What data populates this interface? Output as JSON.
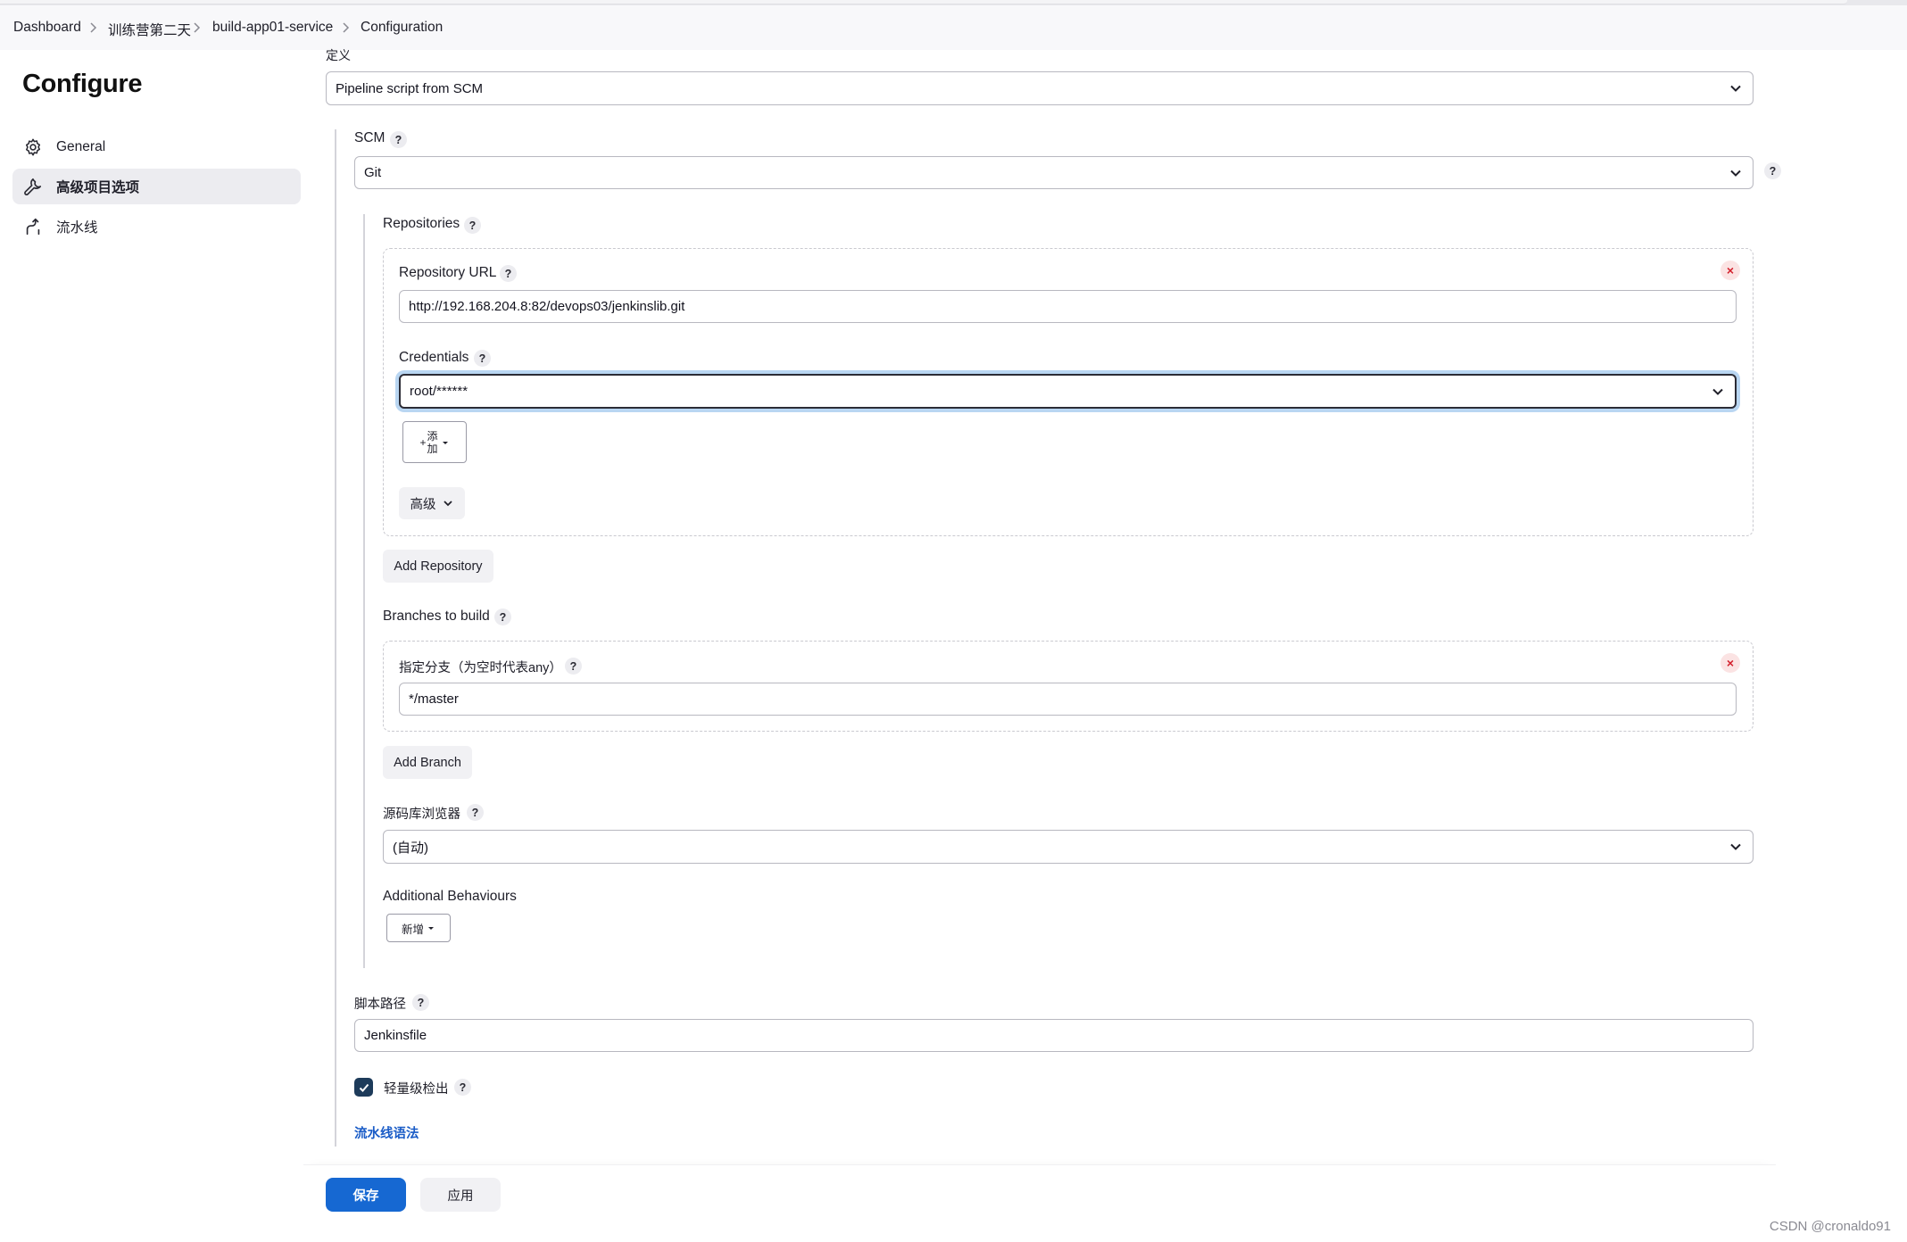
{
  "breadcrumb": {
    "items": [
      "Dashboard",
      "训练营第二天",
      "build-app01-service",
      "Configuration"
    ]
  },
  "sidebar": {
    "title": "Configure",
    "items": [
      {
        "label": "General",
        "icon": "gear-icon"
      },
      {
        "label": "高级项目选项",
        "icon": "wrench-icon",
        "active": true
      },
      {
        "label": "流水线",
        "icon": "pipeline-icon"
      }
    ]
  },
  "definition": {
    "label": "定义",
    "value": "Pipeline script from SCM"
  },
  "scm": {
    "label": "SCM",
    "value": "Git"
  },
  "repositories": {
    "label": "Repositories",
    "url_label": "Repository URL",
    "url_value": "http://192.168.204.8:82/devops03/jenkinslib.git",
    "credentials_label": "Credentials",
    "credentials_value": "root/******",
    "add_label_line1": "添",
    "add_label_line2": "加",
    "add_prefix": "+",
    "advanced_label": "高级",
    "add_repository_label": "Add Repository"
  },
  "branches": {
    "label": "Branches to build",
    "spec_label": "指定分支（为空时代表any）",
    "spec_value": "*/master",
    "add_branch_label": "Add Branch"
  },
  "browser": {
    "label": "源码库浏览器",
    "value": "(自动)"
  },
  "behaviours": {
    "label": "Additional Behaviours",
    "add_label": "新增"
  },
  "script_path": {
    "label": "脚本路径",
    "value": "Jenkinsfile"
  },
  "lightweight": {
    "label": "轻量级检出",
    "checked": true
  },
  "syntax_link": "流水线语法",
  "footer": {
    "save_label": "保存",
    "apply_label": "应用"
  },
  "help_glyph": "?",
  "delete_glyph": "×",
  "watermark": "CSDN @cronaldo91",
  "colors": {
    "primary": "#1668d2",
    "link": "#1a5cc7",
    "delete": "#d3212d",
    "focus_ring": "#b9d6f2",
    "checkbox": "#1d3b5a"
  }
}
